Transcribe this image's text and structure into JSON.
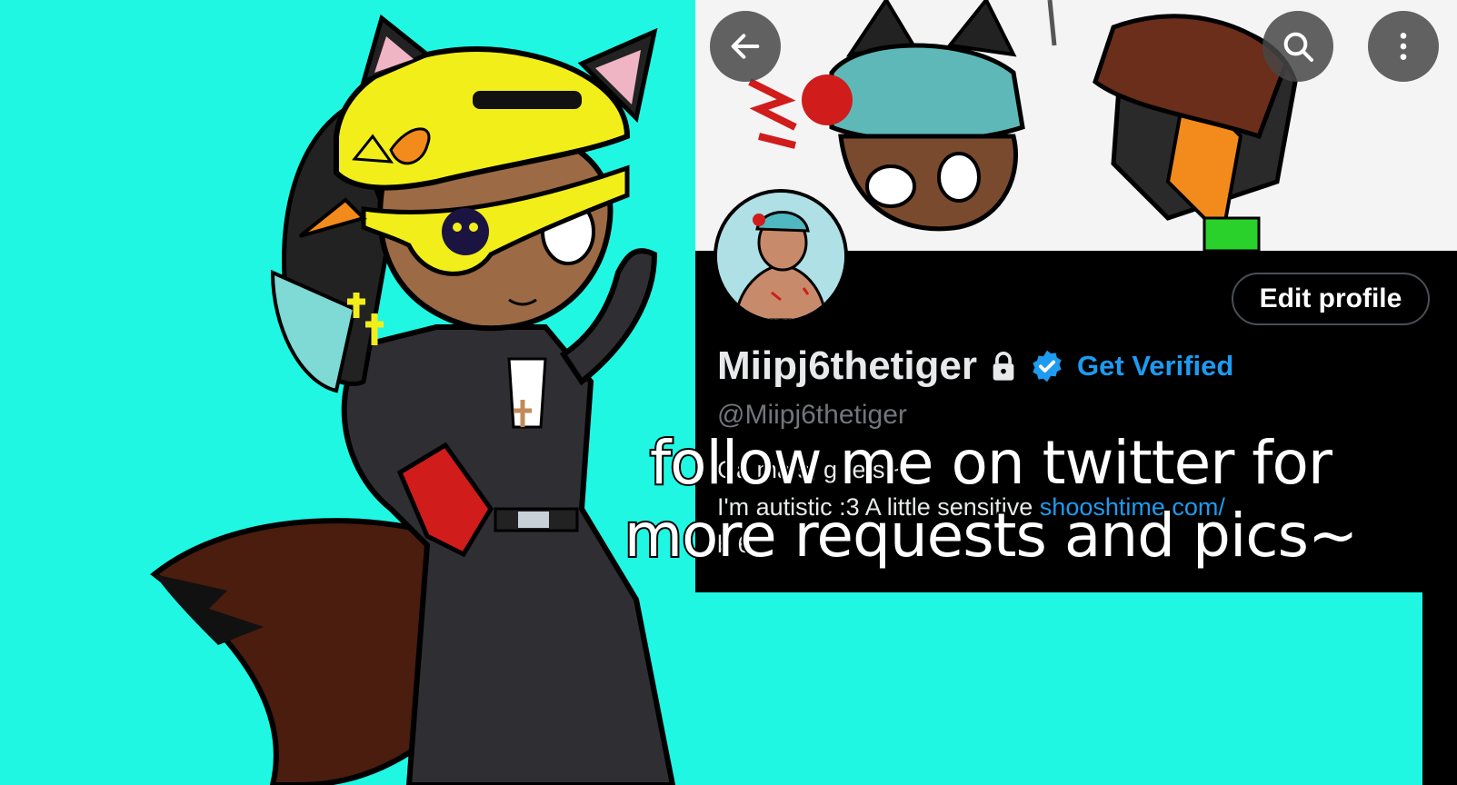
{
  "colors": {
    "background": "#1ff7e3",
    "profile_background": "#000000",
    "accent_blue": "#1d9bf0",
    "caption_fill": "#ffffff",
    "caption_stroke": "#000000"
  },
  "profile": {
    "back_icon": "arrow-left-icon",
    "search_icon": "search-icon",
    "more_icon": "more-vertical-icon",
    "edit_profile_label": "Edit profile",
    "display_name": "Miipj6thetiger",
    "lock_icon": "lock-icon",
    "verified_icon": "verified-badge-icon",
    "get_verified_label": "Get Verified",
    "handle": "@Miipj6thetiger",
    "bio_line1": "Ga ma   s,    g                     re       s~",
    "bio_line2_text": "I'm autistic :3 A little sensitive ",
    "bio_line2_link": "shooshtime.com/",
    "bio_line3": "b            6"
  },
  "caption": {
    "line1": "follow me on twitter for",
    "line2": "more requests and pics~"
  }
}
